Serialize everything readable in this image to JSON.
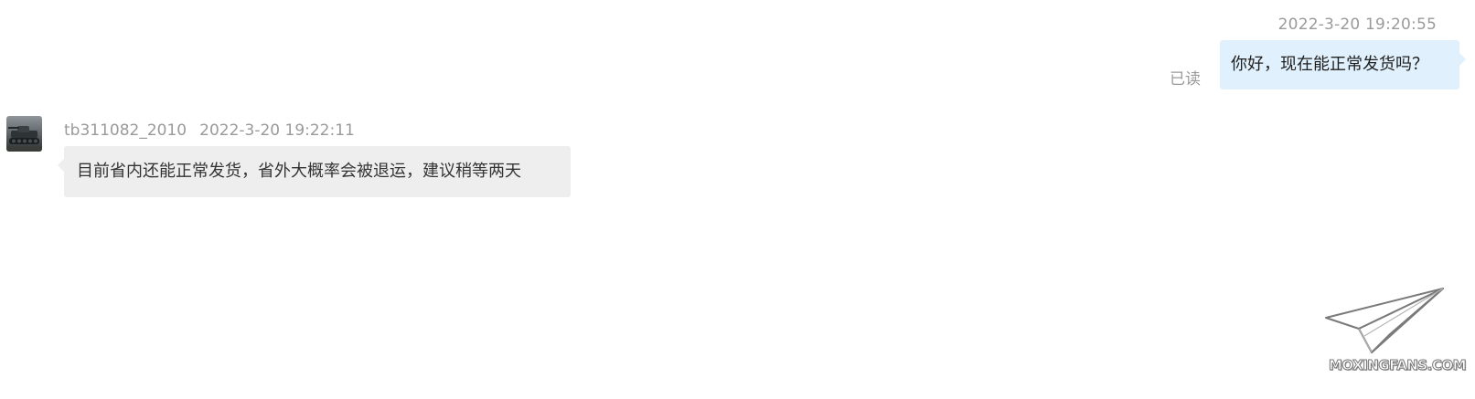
{
  "outgoing": {
    "timestamp": "2022-3-20 19:20:55",
    "read_status": "已读",
    "text": "你好，现在能正常发货吗？"
  },
  "incoming": {
    "sender": "tb311082_2010",
    "timestamp": "2022-3-20 19:22:11",
    "text": "目前省内还能正常发货，省外大概率会被退运，建议稍等两天"
  },
  "watermark": {
    "text": "MOXINGFANS.COM",
    "icon": "paper-plane-icon"
  },
  "colors": {
    "outgoing_bubble": "#e0f0fc",
    "incoming_bubble": "#eeeeee",
    "meta_text": "#9a9a9a"
  }
}
